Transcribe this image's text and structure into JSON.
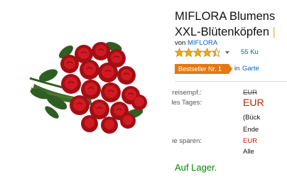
{
  "product": {
    "title_line1": "MIFLORA Blumens",
    "title_line2": "XXL-Blütenköpfen",
    "title_line2_suffix": "|",
    "by_prefix": "von",
    "brand": "MIFLORA",
    "rating": 4.5,
    "review_count": "55 Ku",
    "badge": "Bestseller Nr. 1",
    "in_text": "in",
    "category": "Garte"
  },
  "pricing": {
    "list_price_label": "Unverb. Preisempf.:",
    "list_price": "EUR",
    "deal_label": "Angebot des Tages:",
    "deal_price": "EUR",
    "note_line1": "(Bück",
    "note_line2": "Ende",
    "savings_label": "Sie sparen:",
    "savings_value": "EUR",
    "note_line3": "Alle"
  },
  "availability": "Auf Lager.",
  "colors": {
    "rose_red": "#c0141c",
    "accent_orange": "#e47911",
    "link_blue": "#0066c0",
    "price_red": "#b12704",
    "stock_green": "#008a00",
    "star_gold": "#f0a61c"
  }
}
